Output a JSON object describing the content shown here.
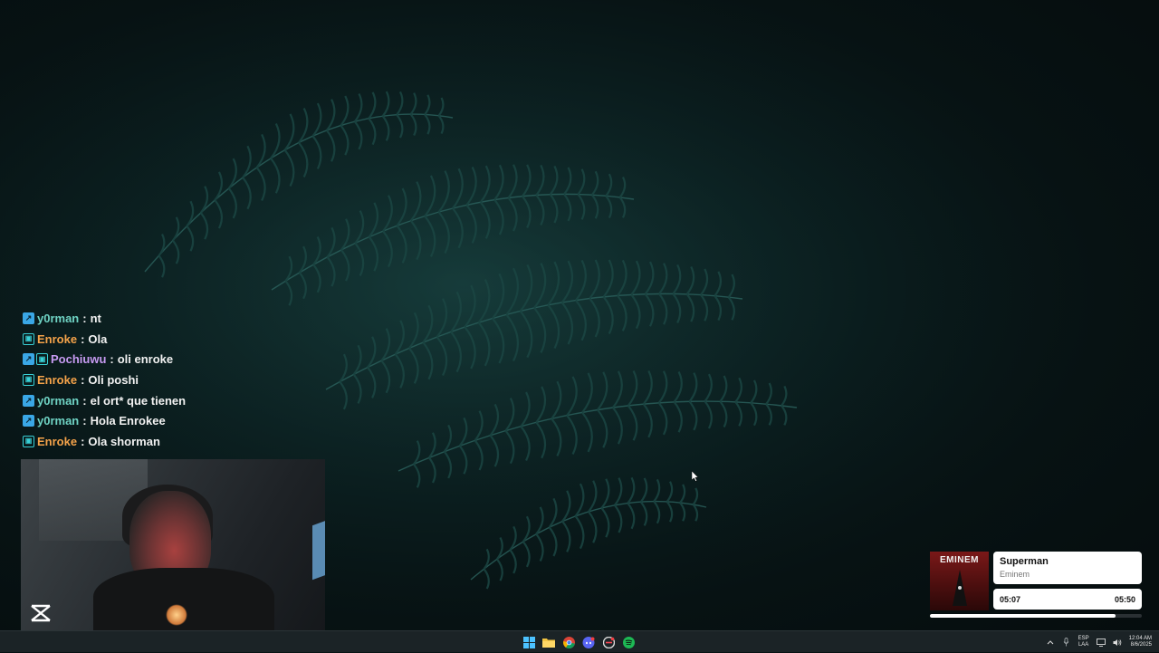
{
  "chat": {
    "messages": [
      {
        "user": "y0rman",
        "text": "nt",
        "badges": [
          "ax-icon"
        ],
        "color": "#6fd3c4"
      },
      {
        "user": "Enroke",
        "text": "Ola",
        "badges": [
          "gg-icon"
        ],
        "color": "#f5a34a"
      },
      {
        "user": "Pochiuwu",
        "text": "oli enroke",
        "badges": [
          "ax-icon",
          "gg-icon"
        ],
        "color": "#c79bf2"
      },
      {
        "user": "Enroke",
        "text": "Oli poshi",
        "badges": [
          "gg-icon"
        ],
        "color": "#f5a34a"
      },
      {
        "user": "y0rman",
        "text": "el ort* que tienen",
        "badges": [
          "ax-icon"
        ],
        "color": "#6fd3c4"
      },
      {
        "user": "y0rman",
        "text": "Hola Enrokee",
        "badges": [
          "ax-icon"
        ],
        "color": "#6fd3c4"
      },
      {
        "user": "Enroke",
        "text": "Ola shorman",
        "badges": [
          "gg-icon"
        ],
        "color": "#f5a34a"
      }
    ],
    "separator": ":"
  },
  "music": {
    "album_text": "EMINEM",
    "title": "Superman",
    "artist": "Eminem",
    "elapsed": "05:07",
    "duration": "05:50",
    "progress_fraction": 0.877
  },
  "taskbar": {
    "apps": [
      "windows-start-icon",
      "file-explorer-icon",
      "chrome-icon",
      "discord-icon",
      "game-launcher-icon",
      "spotify-icon"
    ],
    "lang_top": "ESP",
    "lang_bottom": "LAA",
    "time": "12:04 AM",
    "date": "8/6/2025"
  }
}
